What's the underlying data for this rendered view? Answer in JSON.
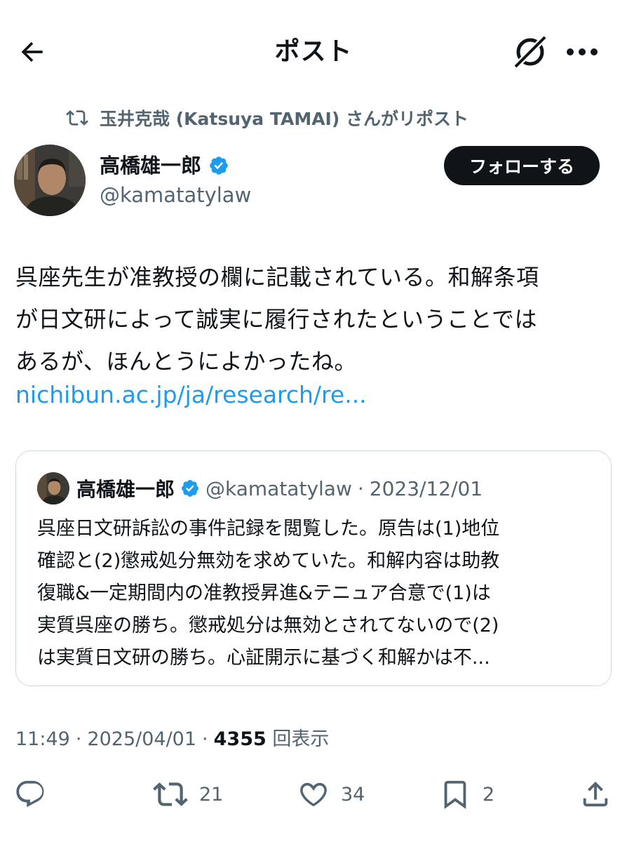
{
  "header": {
    "title": "ポスト",
    "back_icon": "arrow-left-icon",
    "grok_icon": "grok-icon",
    "more_icon": "more-horizontal-icon"
  },
  "repost": {
    "icon": "repost-icon",
    "text": "玉井克哉 (Katsuya TAMAI) さんがリポスト"
  },
  "author": {
    "name": "高橋雄一郎",
    "handle": "@kamatatylaw",
    "verified": true,
    "follow_label": "フォローする"
  },
  "post": {
    "lines": [
      "呉座先生が准教授の欄に記載されている。和解条項",
      "が日文研によって誠実に履行されたということでは",
      "あるが、ほんとうによかったね。"
    ],
    "link": "nichibun.ac.jp/ja/research/re..."
  },
  "quote": {
    "name": "高橋雄一郎",
    "handle": "@kamatatylaw",
    "separator": "·",
    "date": "2023/12/01",
    "lines": [
      "呉座日文研訴訟の事件記録を閲覧した。原告は(1)地位",
      "確認と(2)懲戒処分無効を求めていた。和解内容は助教",
      "復職&一定期間内の准教授昇進&テニュア合意で(1)は",
      "実質呉座の勝ち。懲戒処分は無効とされてないので(2)",
      "は実質日文研の勝ち。心証開示に基づく和解かは不..."
    ]
  },
  "meta": {
    "time": "11:49",
    "sep1": "·",
    "date": "2025/04/01",
    "sep2": "·",
    "views_count": "4355",
    "views_label": "回表示"
  },
  "actions": {
    "reply": {
      "icon": "reply-icon",
      "count": ""
    },
    "repost": {
      "icon": "repost-icon",
      "count": "21"
    },
    "like": {
      "icon": "heart-icon",
      "count": "34"
    },
    "bookmark": {
      "icon": "bookmark-icon",
      "count": "2"
    },
    "share": {
      "icon": "share-icon",
      "count": ""
    }
  },
  "colors": {
    "text": "#0f1419",
    "secondary": "#536471",
    "link": "#1d9bf0",
    "verified": "#1d9bf0",
    "border": "#cfd9de"
  }
}
